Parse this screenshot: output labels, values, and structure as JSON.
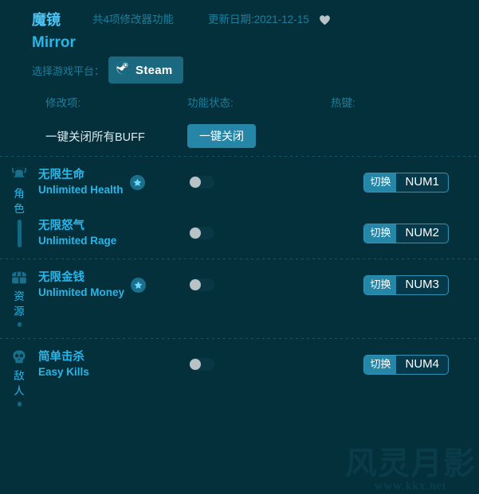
{
  "header": {
    "title_cn": "魔镜",
    "title_en": "Mirror",
    "feature_count_text": "共4项修改器功能",
    "update_date_text": "更新日期:2021-12-15",
    "favorite_icon": "heart-icon"
  },
  "platform": {
    "label": "选择游戏平台：",
    "selected": "Steam",
    "icon": "steam-icon"
  },
  "columns": {
    "name": "修改项:",
    "status": "功能状态:",
    "hotkey": "热键:"
  },
  "one_click": {
    "name": "一键关闭所有BUFF",
    "button_label": "一键关闭"
  },
  "sections": [
    {
      "category_cn": "角色",
      "icon": "helmet-icon",
      "rows": [
        {
          "name_cn": "无限生命",
          "name_en": "Unlimited Health",
          "starred": true,
          "toggle_on": false,
          "hotkey_mode": "切换",
          "hotkey_key": "NUM1"
        },
        {
          "name_cn": "无限怒气",
          "name_en": "Unlimited Rage",
          "starred": false,
          "toggle_on": false,
          "hotkey_mode": "切换",
          "hotkey_key": "NUM2"
        }
      ]
    },
    {
      "category_cn": "资源",
      "icon": "chest-icon",
      "rows": [
        {
          "name_cn": "无限金钱",
          "name_en": "Unlimited Money",
          "starred": true,
          "toggle_on": false,
          "hotkey_mode": "切换",
          "hotkey_key": "NUM3"
        }
      ]
    },
    {
      "category_cn": "敌人",
      "icon": "skull-icon",
      "rows": [
        {
          "name_cn": "简单击杀",
          "name_en": "Easy Kills",
          "starred": false,
          "toggle_on": false,
          "hotkey_mode": "切换",
          "hotkey_key": "NUM4"
        }
      ]
    }
  ],
  "watermark": {
    "glyphs": "风灵月影",
    "url": "www.kkx.net"
  },
  "colors": {
    "background": "#04303c",
    "accent": "#29b6e8",
    "muted": "#1c7f9c",
    "button": "#2586a8",
    "steam_button": "#1b6980"
  }
}
